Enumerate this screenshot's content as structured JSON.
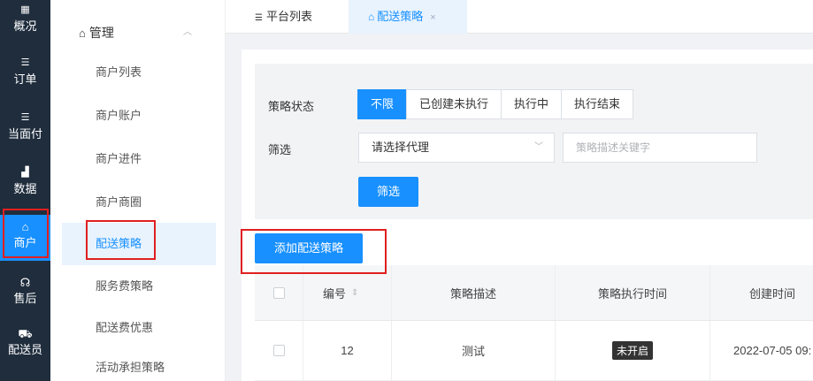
{
  "nav": {
    "items": [
      {
        "label": "概况",
        "icon": "grid-icon",
        "glyph": "▦"
      },
      {
        "label": "订单",
        "icon": "list-icon",
        "glyph": "☰"
      },
      {
        "label": "当面付",
        "icon": "list-icon",
        "glyph": "☰"
      },
      {
        "label": "数据",
        "icon": "bar-chart-icon",
        "glyph": "▟"
      },
      {
        "label": "商户",
        "icon": "store-icon",
        "glyph": "⌂"
      },
      {
        "label": "售后",
        "icon": "headset-icon",
        "glyph": "☊"
      },
      {
        "label": "配送员",
        "icon": "courier-icon",
        "glyph": "⛟"
      }
    ],
    "active_index": 4
  },
  "subnav": {
    "group_title": "管理",
    "group_icon": "store-icon",
    "items": [
      "商户列表",
      "商户账户",
      "商户进件",
      "商户商圈",
      "配送策略",
      "服务费策略",
      "配送费优惠",
      "活动承担策略"
    ],
    "active_index": 4
  },
  "tabs": [
    {
      "label": "平台列表",
      "icon": "list-icon"
    },
    {
      "label": "配送策略",
      "icon": "store-icon",
      "close": "×"
    }
  ],
  "filter": {
    "status_label": "策略状态",
    "status_options": [
      "不限",
      "已创建未执行",
      "执行中",
      "执行结束"
    ],
    "status_active_index": 0,
    "filter_label": "筛选",
    "agent_select_value": "请选择代理",
    "keyword_placeholder": "策略描述关键字",
    "filter_button": "筛选"
  },
  "add_button": "添加配送策略",
  "table": {
    "columns": [
      "编号",
      "策略描述",
      "策略执行时间",
      "创建时间"
    ],
    "rows": [
      {
        "id": "12",
        "desc": "测试",
        "exec_time_tag": "未开启",
        "created": "2022-07-05 09:"
      }
    ]
  },
  "colors": {
    "accent": "#1890ff",
    "nav_bg": "#1f2d3d",
    "highlight_border": "#e02020"
  }
}
